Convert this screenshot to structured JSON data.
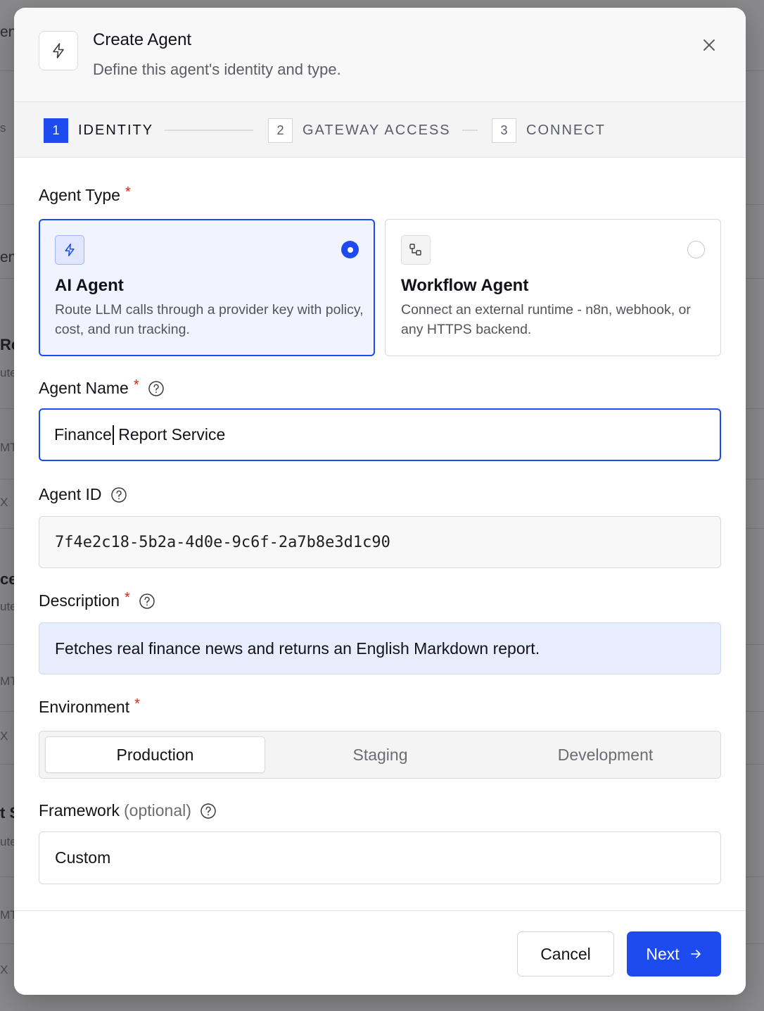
{
  "background": {
    "fragments": [
      "en",
      "s",
      "en",
      "Re",
      "ute",
      "MT",
      "X",
      "ce",
      "ute",
      "MT",
      "X",
      "t S",
      "ute",
      "MT",
      "X"
    ]
  },
  "modal": {
    "title": "Create Agent",
    "subtitle": "Define this agent's identity and type.",
    "header_icon": "lightning-icon",
    "close_icon": "close-icon"
  },
  "stepper": {
    "steps": [
      {
        "number": "1",
        "label": "IDENTITY",
        "active": true
      },
      {
        "number": "2",
        "label": "GATEWAY ACCESS",
        "active": false
      },
      {
        "number": "3",
        "label": "CONNECT",
        "active": false
      }
    ]
  },
  "agent_type": {
    "label": "Agent Type",
    "required_mark": "*",
    "options": [
      {
        "title": "AI Agent",
        "description": "Route LLM calls through a provider key with policy, cost, and run tracking.",
        "icon": "lightning-icon",
        "selected": true
      },
      {
        "title": "Workflow Agent",
        "description": "Connect an external runtime - n8n, webhook, or any HTTPS backend.",
        "icon": "workflow-icon",
        "selected": false
      }
    ]
  },
  "agent_name": {
    "label": "Agent Name",
    "required_mark": "*",
    "value_before_caret": "Finance",
    "value_after_caret": " Report Service"
  },
  "agent_id": {
    "label": "Agent ID",
    "value": "7f4e2c18-5b2a-4d0e-9c6f-2a7b8e3d1c90"
  },
  "description": {
    "label": "Description",
    "required_mark": "*",
    "value": "Fetches real finance news and returns an English Markdown report."
  },
  "environment": {
    "label": "Environment",
    "required_mark": "*",
    "options": [
      "Production",
      "Staging",
      "Development"
    ],
    "selected": "Production"
  },
  "framework": {
    "label": "Framework",
    "optional_text": "(optional)",
    "value": "Custom"
  },
  "footer": {
    "cancel_label": "Cancel",
    "next_label": "Next"
  },
  "colors": {
    "accent": "#1d4bf0",
    "required": "#d0261b"
  }
}
